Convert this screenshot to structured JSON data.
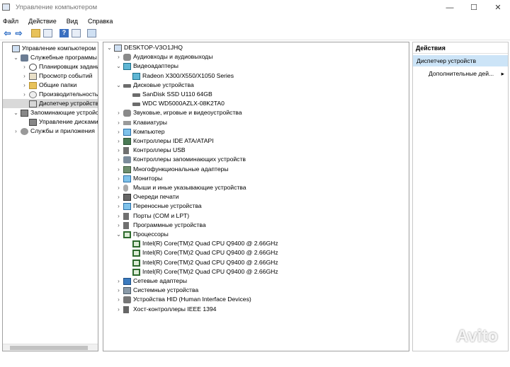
{
  "window": {
    "title": "Управление компьютером",
    "controls": {
      "minimize": "—",
      "maximize": "☐",
      "close": "✕"
    }
  },
  "menu": [
    "Файл",
    "Действие",
    "Вид",
    "Справка"
  ],
  "toolbar": {
    "back_icon": "back-arrow-icon",
    "forward_icon": "forward-arrow-icon",
    "back_glyph": "⇦",
    "forward_glyph": "⇨",
    "help_glyph": "?"
  },
  "left_tree": [
    {
      "label": "Управление компьютером (л",
      "level": 0,
      "exp": "",
      "icon": "i-pc"
    },
    {
      "label": "Служебные программы",
      "level": 1,
      "exp": "⌄",
      "icon": "i-tools"
    },
    {
      "label": "Планировщик заданий",
      "level": 2,
      "exp": "›",
      "icon": "i-clock"
    },
    {
      "label": "Просмотр событий",
      "level": 2,
      "exp": "›",
      "icon": "i-log"
    },
    {
      "label": "Общие папки",
      "level": 2,
      "exp": "›",
      "icon": "i-folder"
    },
    {
      "label": "Производительность",
      "level": 2,
      "exp": "›",
      "icon": "i-perf"
    },
    {
      "label": "Диспетчер устройств",
      "level": 2,
      "exp": "",
      "icon": "i-dev",
      "selected": true
    },
    {
      "label": "Запоминающие устройст",
      "level": 1,
      "exp": "⌄",
      "icon": "i-disk"
    },
    {
      "label": "Управление дисками",
      "level": 2,
      "exp": "",
      "icon": "i-disk"
    },
    {
      "label": "Службы и приложения",
      "level": 1,
      "exp": "›",
      "icon": "i-svc"
    }
  ],
  "device_tree": [
    {
      "label": "DESKTOP-V3O1JHQ",
      "level": 0,
      "exp": "⌄",
      "icon": "i-pc"
    },
    {
      "label": "Аудиовходы и аудиовыходы",
      "level": 1,
      "exp": "›",
      "icon": "i-audio"
    },
    {
      "label": "Видеоадаптеры",
      "level": 1,
      "exp": "⌄",
      "icon": "i-video"
    },
    {
      "label": "Radeon X300/X550/X1050 Series",
      "level": 2,
      "exp": "",
      "icon": "i-video"
    },
    {
      "label": "Дисковые устройства",
      "level": 1,
      "exp": "⌄",
      "icon": "i-drive"
    },
    {
      "label": "SanDisk SSD U110 64GB",
      "level": 2,
      "exp": "",
      "icon": "i-drive"
    },
    {
      "label": "WDC WD5000AZLX-08K2TA0",
      "level": 2,
      "exp": "",
      "icon": "i-drive"
    },
    {
      "label": "Звуковые, игровые и видеоустройства",
      "level": 1,
      "exp": "›",
      "icon": "i-audio"
    },
    {
      "label": "Клавиатуры",
      "level": 1,
      "exp": "›",
      "icon": "i-kbd"
    },
    {
      "label": "Компьютер",
      "level": 1,
      "exp": "›",
      "icon": "i-mon"
    },
    {
      "label": "Контроллеры IDE ATA/ATAPI",
      "level": 1,
      "exp": "›",
      "icon": "i-ide"
    },
    {
      "label": "Контроллеры USB",
      "level": 1,
      "exp": "›",
      "icon": "i-usb"
    },
    {
      "label": "Контроллеры запоминающих устройств",
      "level": 1,
      "exp": "›",
      "icon": "i-stor"
    },
    {
      "label": "Многофункциональные адаптеры",
      "level": 1,
      "exp": "›",
      "icon": "i-multi"
    },
    {
      "label": "Мониторы",
      "level": 1,
      "exp": "›",
      "icon": "i-mon"
    },
    {
      "label": "Мыши и иные указывающие устройства",
      "level": 1,
      "exp": "›",
      "icon": "i-mouse"
    },
    {
      "label": "Очереди печати",
      "level": 1,
      "exp": "›",
      "icon": "i-print"
    },
    {
      "label": "Переносные устройства",
      "level": 1,
      "exp": "›",
      "icon": "i-mon"
    },
    {
      "label": "Порты (COM и LPT)",
      "level": 1,
      "exp": "›",
      "icon": "i-port"
    },
    {
      "label": "Программные устройства",
      "level": 1,
      "exp": "›",
      "icon": "i-port"
    },
    {
      "label": "Процессоры",
      "level": 1,
      "exp": "⌄",
      "icon": "i-cpu"
    },
    {
      "label": "Intel(R) Core(TM)2 Quad CPU    Q9400  @ 2.66GHz",
      "level": 2,
      "exp": "",
      "icon": "i-cpu"
    },
    {
      "label": "Intel(R) Core(TM)2 Quad CPU    Q9400  @ 2.66GHz",
      "level": 2,
      "exp": "",
      "icon": "i-cpu"
    },
    {
      "label": "Intel(R) Core(TM)2 Quad CPU    Q9400  @ 2.66GHz",
      "level": 2,
      "exp": "",
      "icon": "i-cpu"
    },
    {
      "label": "Intel(R) Core(TM)2 Quad CPU    Q9400  @ 2.66GHz",
      "level": 2,
      "exp": "",
      "icon": "i-cpu"
    },
    {
      "label": "Сетевые адаптеры",
      "level": 1,
      "exp": "›",
      "icon": "i-net"
    },
    {
      "label": "Системные устройства",
      "level": 1,
      "exp": "›",
      "icon": "i-sys"
    },
    {
      "label": "Устройства HID (Human Interface Devices)",
      "level": 1,
      "exp": "›",
      "icon": "i-hid"
    },
    {
      "label": "Хост-контроллеры IEEE 1394",
      "level": 1,
      "exp": "›",
      "icon": "i-1394"
    }
  ],
  "actions": {
    "header": "Действия",
    "selected": "Диспетчер устройств",
    "more": "Дополнительные дей...",
    "more_arrow": "▸"
  },
  "watermark": "Avito"
}
